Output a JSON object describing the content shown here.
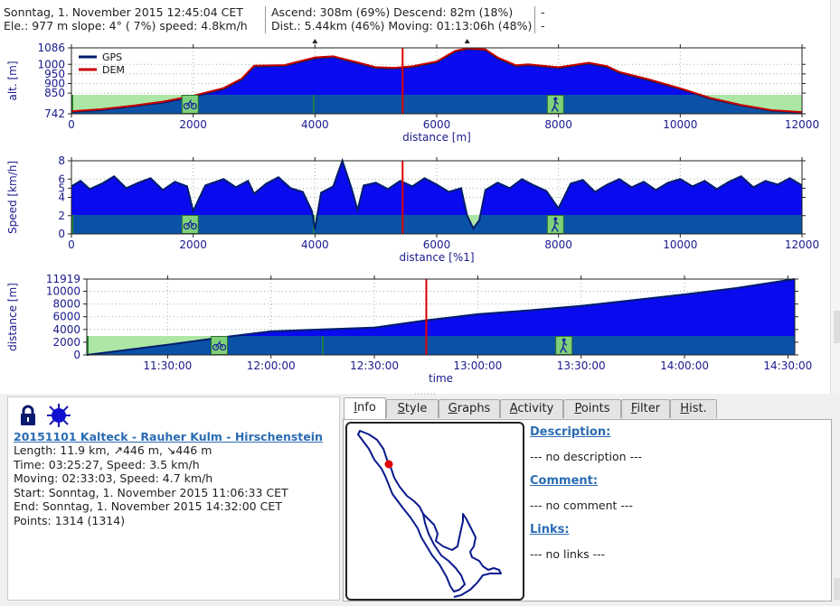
{
  "infobar": {
    "col1": [
      "Sonntag, 1. November 2015 12:45:04 CET",
      "Ele.: 977 m slope:  4° ( 7%) speed: 4.8km/h"
    ],
    "col2": [
      "Ascend: 308m (69%) Descend: 82m (18%)",
      "Dist.: 5.44km (46%) Moving: 01:13:06h (48%)"
    ],
    "col3": [
      "-",
      "-"
    ]
  },
  "colors": {
    "fill": "#0a0aee",
    "line": "#001d6b",
    "dem": "#c80000",
    "cursor": "#e00000",
    "segment_bike": "#a8e6a0",
    "band": "#0a52a8"
  },
  "chart_data": [
    {
      "type": "area",
      "title": "",
      "ylabel": "alt. [m]",
      "xlabel": "distance [m]",
      "xlim": [
        0,
        12000
      ],
      "ylim": [
        742,
        1086
      ],
      "yticks": [
        "1086",
        "1000",
        "950",
        "900",
        "850",
        "742"
      ],
      "xticks": [
        "0",
        "2000",
        "4000",
        "6000",
        "8000",
        "10000",
        "12000"
      ],
      "legend": [
        "GPS",
        "DEM"
      ],
      "cursor_x": 5440,
      "series": [
        {
          "name": "GPS",
          "x": [
            0,
            500,
            1000,
            1500,
            2000,
            2500,
            2800,
            3000,
            3500,
            4000,
            4300,
            4700,
            5000,
            5300,
            5600,
            6000,
            6300,
            6500,
            6800,
            7000,
            7300,
            7500,
            8000,
            8500,
            8800,
            9000,
            9500,
            10000,
            10500,
            11000,
            11500,
            12000
          ],
          "y": [
            752,
            762,
            780,
            800,
            830,
            870,
            920,
            988,
            992,
            1030,
            1038,
            1005,
            980,
            978,
            985,
            1010,
            1065,
            1080,
            1075,
            1030,
            990,
            995,
            980,
            1003,
            985,
            955,
            915,
            870,
            820,
            785,
            758,
            748
          ]
        },
        {
          "name": "DEM",
          "x": [
            0,
            500,
            1000,
            1500,
            2000,
            2500,
            2800,
            3000,
            3500,
            4000,
            4300,
            4700,
            5000,
            5300,
            5600,
            6000,
            6300,
            6500,
            6800,
            7000,
            7300,
            7500,
            8000,
            8500,
            8800,
            9000,
            9500,
            10000,
            10500,
            11000,
            11500,
            12000
          ],
          "y": [
            755,
            766,
            784,
            805,
            836,
            876,
            926,
            993,
            996,
            1036,
            1042,
            1010,
            985,
            982,
            990,
            1015,
            1070,
            1083,
            1078,
            1036,
            995,
            1000,
            985,
            1008,
            990,
            960,
            920,
            875,
            824,
            788,
            761,
            751
          ]
        }
      ]
    },
    {
      "type": "area",
      "title": "",
      "ylabel": "Speed [km/h]",
      "xlabel": "distance [%1]",
      "xlim": [
        0,
        12000
      ],
      "ylim": [
        0,
        8
      ],
      "yticks": [
        "8",
        "6",
        "5",
        "4",
        "2",
        "0"
      ],
      "xticks": [
        "0",
        "2000",
        "4000",
        "6000",
        "8000",
        "10000",
        "12000"
      ],
      "cursor_x": 5440,
      "x": [
        0,
        150,
        300,
        500,
        700,
        900,
        1100,
        1300,
        1500,
        1700,
        1900,
        2000,
        2200,
        2500,
        2700,
        2900,
        3000,
        3200,
        3400,
        3600,
        3800,
        3950,
        4000,
        4100,
        4300,
        4450,
        4500,
        4600,
        4700,
        4800,
        5000,
        5200,
        5400,
        5600,
        5800,
        6000,
        6200,
        6400,
        6500,
        6600,
        6700,
        6800,
        7000,
        7200,
        7400,
        7600,
        7800,
        8000,
        8200,
        8400,
        8600,
        8800,
        9000,
        9200,
        9400,
        9600,
        9800,
        10000,
        10200,
        10400,
        10600,
        10800,
        11000,
        11200,
        11400,
        11600,
        11800,
        12000
      ],
      "values": [
        5.2,
        5.8,
        4.9,
        5.5,
        6.3,
        5.0,
        5.6,
        6.1,
        4.8,
        5.7,
        5.2,
        2.5,
        5.3,
        6.0,
        5.1,
        5.8,
        4.4,
        5.5,
        6.2,
        5.0,
        4.6,
        2.5,
        0.5,
        4.5,
        5.2,
        8.0,
        7.0,
        5.0,
        2.6,
        5.3,
        5.6,
        4.9,
        5.8,
        5.2,
        6.1,
        5.4,
        4.6,
        5.0,
        2.0,
        0.6,
        1.5,
        4.8,
        5.6,
        5.0,
        6.0,
        5.3,
        4.7,
        2.8,
        5.5,
        5.9,
        4.6,
        5.4,
        6.0,
        5.1,
        5.7,
        4.8,
        5.6,
        6.0,
        5.2,
        5.8,
        4.9,
        5.7,
        6.3,
        5.1,
        5.8,
        5.4,
        6.1,
        5.3
      ]
    },
    {
      "type": "area",
      "title": "",
      "ylabel": "distance [m]",
      "xlabel": "time",
      "xlim": [
        "11:06:33",
        "14:32:00"
      ],
      "ylim": [
        0,
        11919
      ],
      "yticks": [
        "11919",
        "10000",
        "8000",
        "6000",
        "4000",
        "2000",
        "0"
      ],
      "xticks": [
        "11:30:00",
        "12:00:00",
        "12:30:00",
        "13:00:00",
        "13:30:00",
        "14:00:00",
        "14:30:00"
      ],
      "cursor_x": "12:45:04",
      "x": [
        "11:06:33",
        "11:30:00",
        "11:45:00",
        "12:00:00",
        "12:15:00",
        "12:30:00",
        "12:45:04",
        "13:00:00",
        "13:15:00",
        "13:30:00",
        "13:45:00",
        "14:00:00",
        "14:15:00",
        "14:32:00"
      ],
      "values": [
        0,
        1600,
        2700,
        3700,
        4000,
        4300,
        5440,
        6400,
        7000,
        7700,
        8600,
        9500,
        10500,
        11919
      ]
    }
  ],
  "track": {
    "title": "20151101 Kalteck - Rauher Kulm - Hirschenstein",
    "lines": [
      "Length: 11.9 km, ↗446 m, ↘446 m",
      "Time: 03:25:27, Speed: 3.5 km/h",
      "Moving: 02:33:03, Speed: 4.7 km/h",
      "Start: Sonntag, 1. November 2015 11:06:33 CET",
      "End: Sonntag, 1. November 2015 14:32:00 CET",
      "Points: 1314 (1314)"
    ]
  },
  "tabs": [
    "Info",
    "Style",
    "Graphs",
    "Activity",
    "Points",
    "Filter",
    "Hist."
  ],
  "tab_mnemonic": [
    "I",
    "S",
    "G",
    "A",
    "P",
    "F",
    "H"
  ],
  "meta": {
    "description_label": "Description:",
    "description_value": "--- no description ---",
    "comment_label": "Comment:",
    "comment_value": "--- no comment ---",
    "links_label": "Links:",
    "links_value": "--- no links ---"
  },
  "icons": {
    "bike": "bicycle-icon",
    "hike": "hiker-icon",
    "lock": "lock-icon",
    "weather": "sun-icon"
  }
}
